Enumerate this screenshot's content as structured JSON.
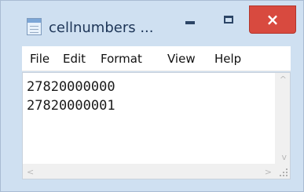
{
  "window": {
    "title": "cellnumbers ...",
    "minimize_symbol": "-",
    "maximize_symbol": "□",
    "close_symbol": "×"
  },
  "menu": {
    "items": [
      "File",
      "Edit",
      "Format",
      "View",
      "Help"
    ]
  },
  "editor": {
    "lines": [
      "27820000000",
      "27820000001"
    ]
  },
  "scrollbars": {
    "up_arrow": "^",
    "down_arrow": "v",
    "left_arrow": "<",
    "right_arrow": ">"
  },
  "icons": {
    "app": "notepad-icon",
    "minimize": "minimize-icon",
    "maximize": "maximize-icon",
    "close": "close-icon"
  },
  "colors": {
    "title_bar": "#cfe0f1",
    "close_button": "#d84a3f",
    "title_text": "#1d3557"
  }
}
